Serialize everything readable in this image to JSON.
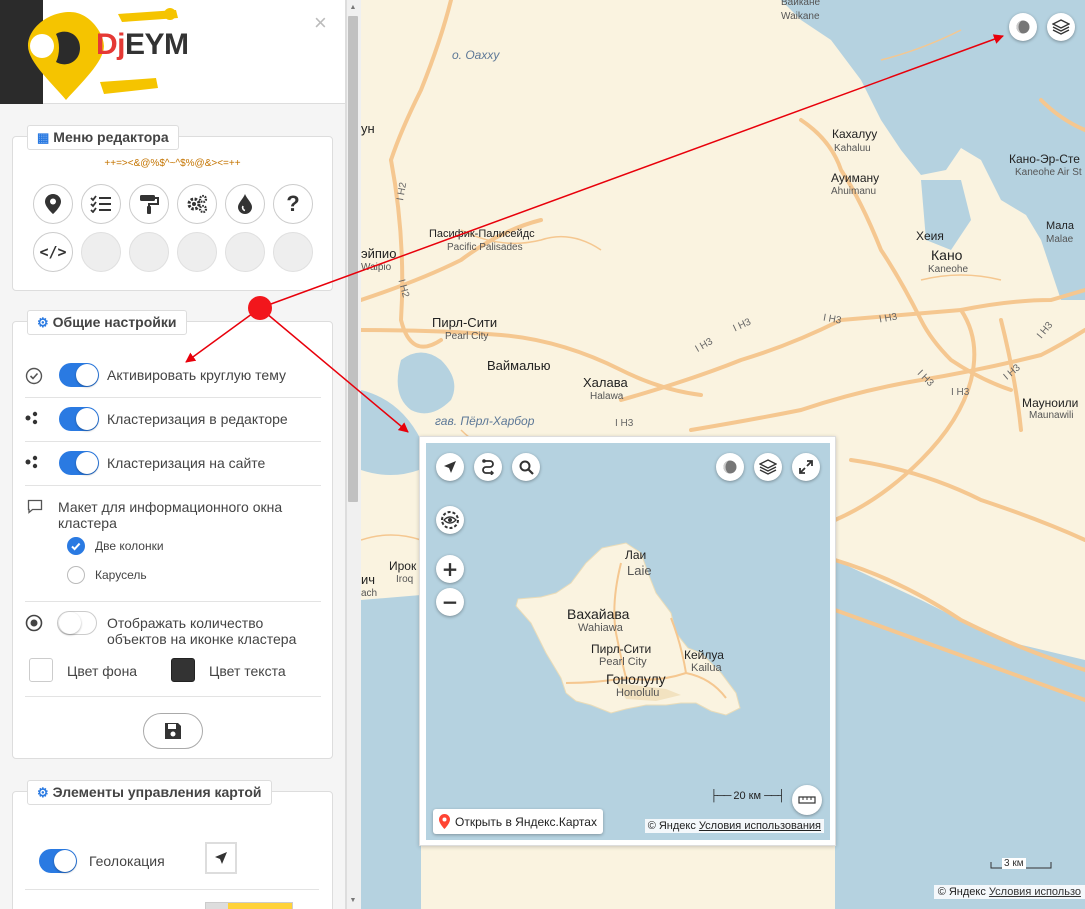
{
  "sidebar": {
    "logo_text_dj": "Dj",
    "logo_text_eym": "EYM",
    "close_icon": "×",
    "menu_panel": {
      "title": "Меню редактора",
      "code_text": "++=><&@%$^~^$%@&><=++",
      "buttons": [
        "map-pin-icon",
        "checklist-icon",
        "paint-roller-icon",
        "gears-icon",
        "drop-icon",
        "question-icon",
        "code-icon",
        "",
        "",
        "",
        "",
        ""
      ]
    },
    "general_panel": {
      "title": "Общие настройки",
      "round_theme": "Активировать круглую тему",
      "cluster_editor": "Кластеризация в редакторе",
      "cluster_site": "Кластеризация на сайте",
      "layout_label_1": "Макет для информационного окна",
      "layout_label_2": "кластера",
      "radio_two_columns": "Две колонки",
      "radio_carousel": "Карусель",
      "show_count_1": "Отображать количество",
      "show_count_2": "объектов на иконке кластера",
      "bg_color": "Цвет фона",
      "text_color": "Цвет текста"
    },
    "controls_panel": {
      "title": "Элементы управления картой",
      "geolocation": "Геолокация"
    }
  },
  "map": {
    "labels": {
      "waikane_ru": "Вайкане",
      "waikane": "Waikane",
      "oahu": "о. Оахху",
      "un": "ун",
      "kahaluu_ru": "Кахалуу",
      "kahaluu": "Kahaluu",
      "ahuimanu_ru": "Ауиману",
      "ahuimanu": "Ahuimanu",
      "kaneohe_air_ru": "Кано-Эр-Сте",
      "kaneohe_air": "Kaneohe Air St",
      "pacific_pal_ru": "Пасифик-Палисейдс",
      "pacific_pal": "Pacific Palisades",
      "heeia_ru": "Хеия",
      "kaneohe_ru": "Кано",
      "kaneohe": "Kaneohe",
      "mala_ru": "Мала",
      "mala": "Malae",
      "waipio_ru": "эйпио",
      "waipio": "Waipio",
      "pearl_ru": "Пирл-Сити",
      "pearl": "Pearl City",
      "waimalu_ru": "Ваймалью",
      "halawa_ru": "Халава",
      "halawa": "Halawa",
      "maunawili_ru": "Мауноили",
      "maunawili": "Maunawili",
      "pearl_harbor": "гав. Пёрл-Харбор",
      "iroq_ru": "Ирок",
      "iroq": "Iroq",
      "ich": "ич",
      "ach": "ach"
    },
    "highways": [
      "I H2",
      "I H2",
      "I H3",
      "I H3",
      "I H3",
      "I H3",
      "I H3",
      "I H3",
      "I H3",
      "I H3",
      "I H3"
    ],
    "scale": "3 км",
    "copyright": "© Яндекс",
    "terms": "Условия использо"
  },
  "inset": {
    "labels": {
      "laie_ru": "Лаи",
      "laie": "Laie",
      "wahiawa_ru": "Вахайава",
      "wahiawa": "Wahiawa",
      "pearl_ru": "Пирл-Сити",
      "pearl": "Pearl City",
      "kailua_ru": "Кейлуа",
      "kailua": "Kailua",
      "honolulu_ru": "Гонолулу",
      "honolulu": "Honolulu"
    },
    "open_yandex": "Открыть в Яндекс.Картах",
    "scale": "20 км",
    "copyright": "© Яндекс",
    "terms": "Условия использования"
  },
  "colors": {
    "accent": "#2a7ae2",
    "sea": "#b5d2e0",
    "land": "#faf3e0",
    "road": "#f7c78a",
    "annotation": "#e8000b"
  }
}
